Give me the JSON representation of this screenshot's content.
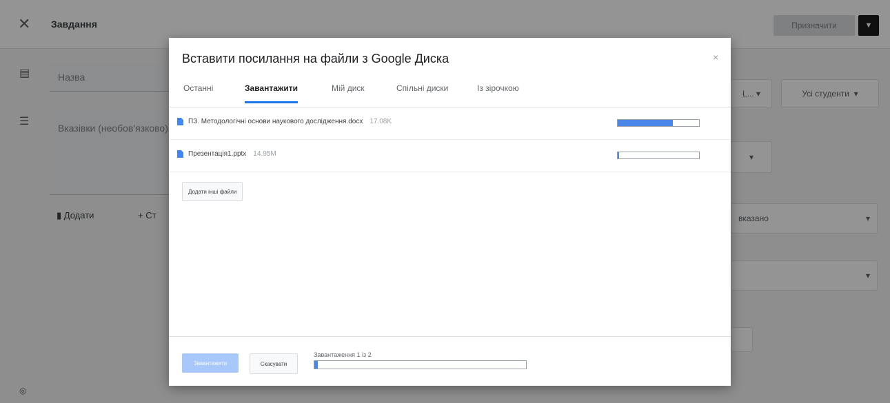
{
  "app": {
    "title": "Завдання",
    "close_icon": "close-icon",
    "assign_label": "Призначити",
    "assign_menu_icon": "chevron-down-icon",
    "title_field_placeholder": "Назва",
    "instructions_placeholder": "Вказівки (необов'язково)",
    "add_label": "Додати",
    "create_label": "+ Ст",
    "students_label": "Усі студенти",
    "right_box_1": "L...",
    "right_box_3": "вказано"
  },
  "dialog": {
    "title": "Вставити посилання на файли з Google Диска",
    "close_label": "×",
    "tabs": [
      {
        "label": "Останні",
        "active": false
      },
      {
        "label": "Завантажити",
        "active": true
      },
      {
        "label": "Мій диск",
        "active": false
      },
      {
        "label": "Спільні диски",
        "active": false
      },
      {
        "label": "Із зірочкою",
        "active": false
      }
    ],
    "files": [
      {
        "name": "ПЗ. Методологічні основи наукового дослідження.docx",
        "size": "17.08K",
        "progress": 0.68,
        "icon": "doc-file-icon"
      },
      {
        "name": "Презентація1.pptx",
        "size": "14.95M",
        "progress": 0.01,
        "icon": "doc-file-icon"
      }
    ],
    "add_files_label": "Додати інші файли",
    "primary_label": "Завантажити",
    "cancel_label": "Скасувати",
    "status_text": "Завантаження 1 із 2",
    "overall_progress": 0.01
  },
  "colors": {
    "accent": "#1a73e8",
    "progress": "#4a86e8",
    "overlay": "rgba(0,0,0,0.42)"
  }
}
